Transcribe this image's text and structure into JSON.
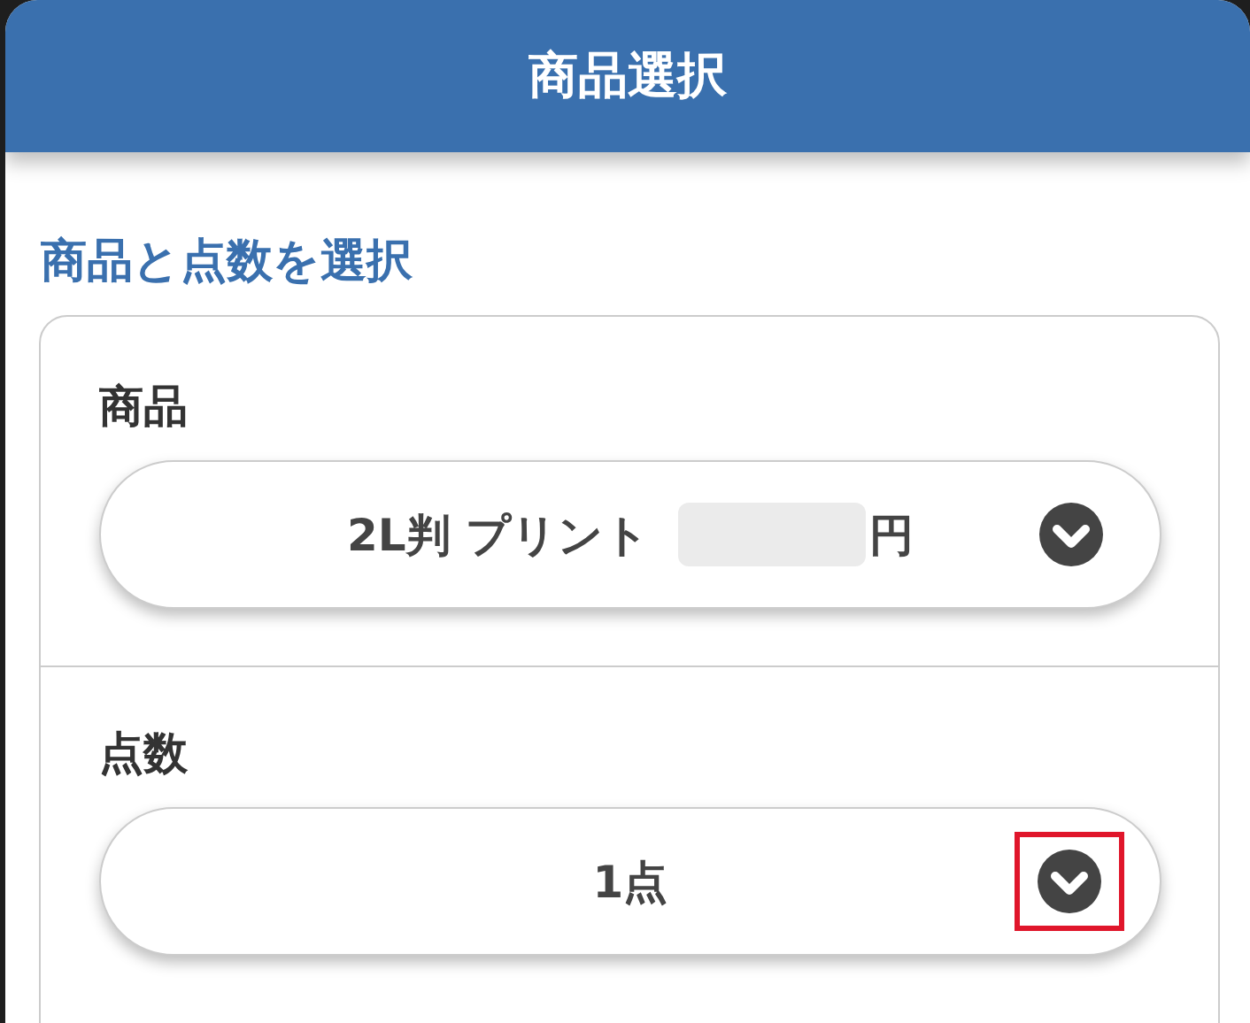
{
  "header": {
    "title": "商品選択"
  },
  "section_title": "商品と点数を選択",
  "fields": [
    {
      "label": "商品",
      "value": "2L判 プリント",
      "suffix": "円",
      "redacted": true,
      "highlighted": false
    },
    {
      "label": "点数",
      "value": "1点",
      "redacted": false,
      "highlighted": true
    }
  ]
}
